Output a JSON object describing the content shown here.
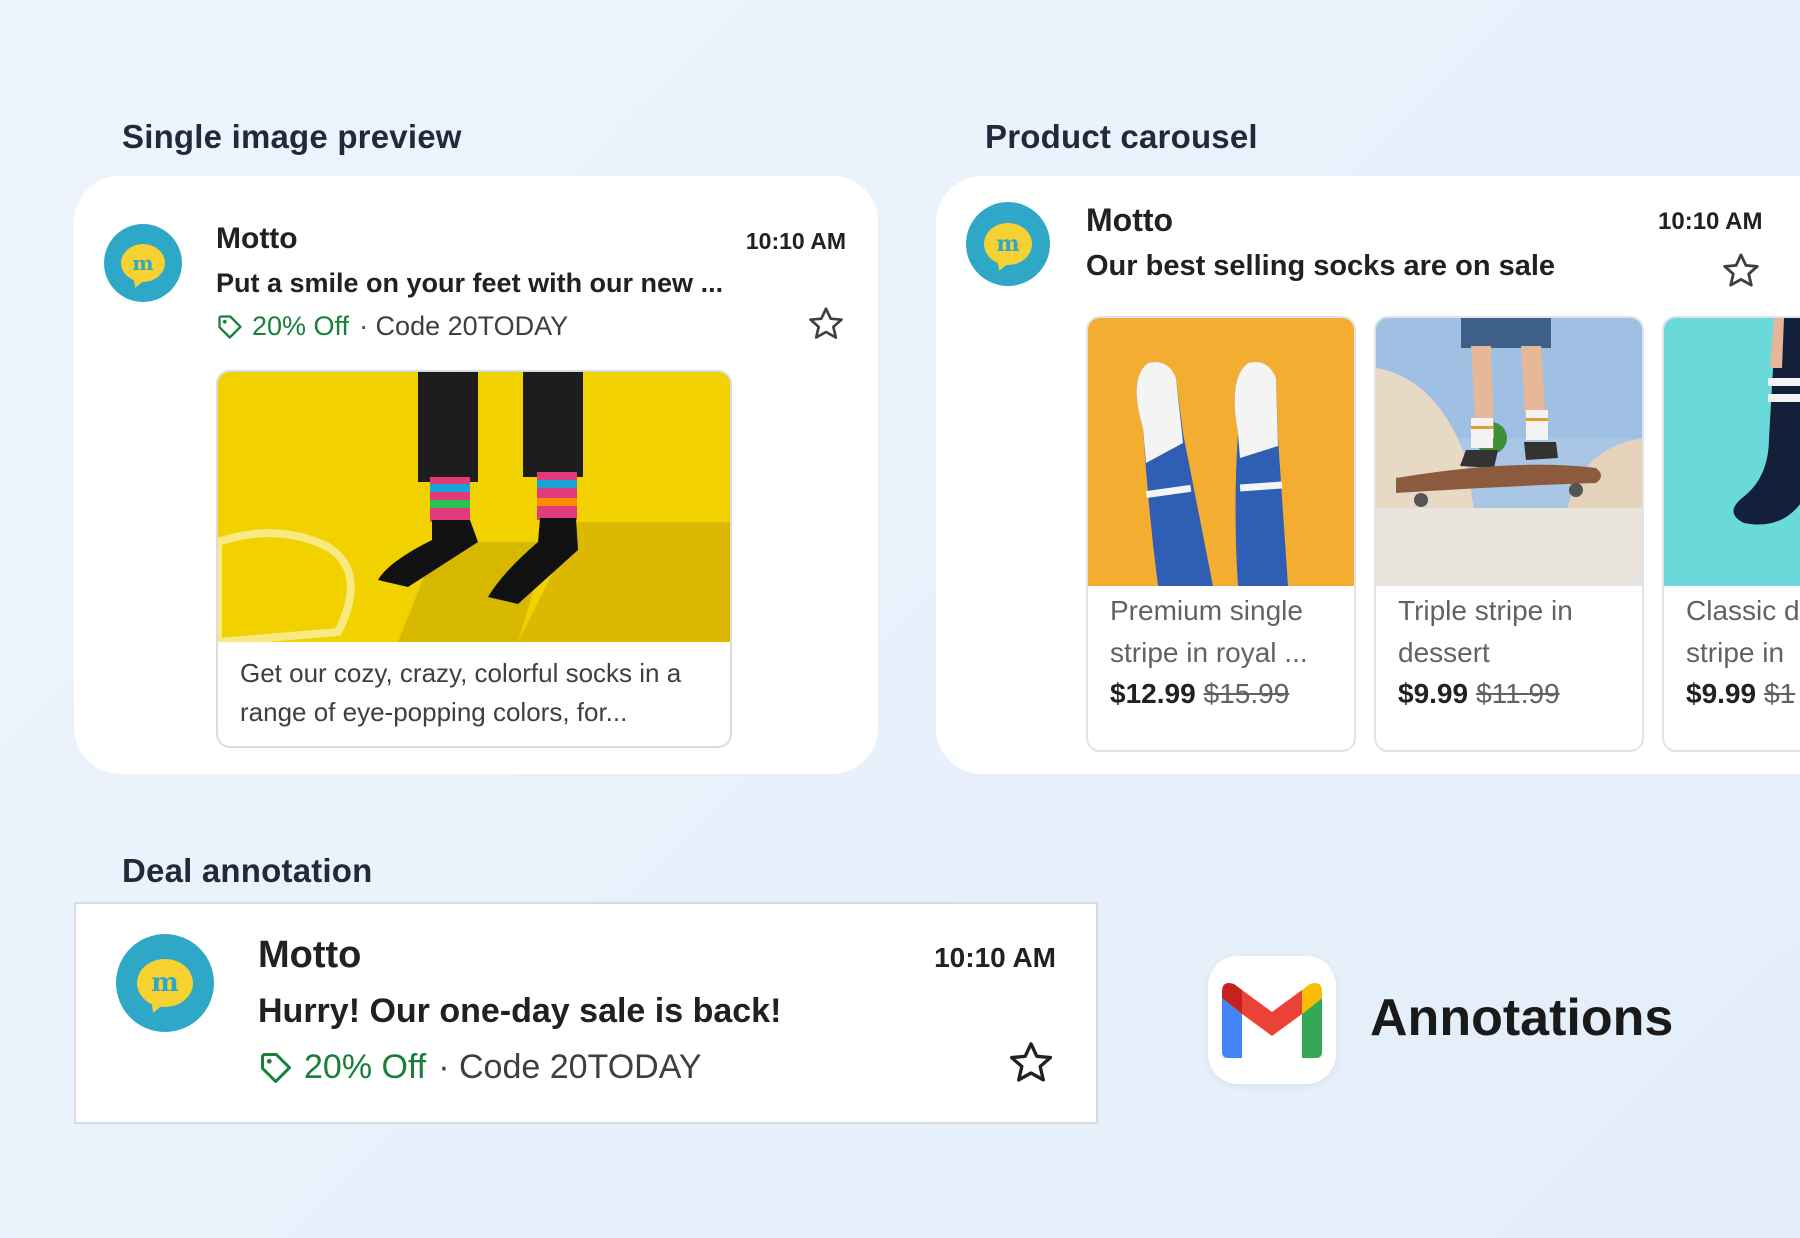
{
  "sections": {
    "single_image_title": "Single image preview",
    "carousel_title": "Product carousel",
    "deal_title": "Deal annotation"
  },
  "colors": {
    "avatar_bg": "#2fa8c8",
    "avatar_bubble": "#f6d132",
    "deal_green": "#188038"
  },
  "single": {
    "avatar_letter": "m",
    "sender": "Motto",
    "time": "10:10 AM",
    "subject": "Put a smile on your feet with our new ...",
    "deal_amount": "20% Off",
    "deal_code": "· Code 20TODAY",
    "star_icon": "star-outline-icon",
    "caption": "Get our cozy, crazy, colorful socks in a range of eye-popping colors, for..."
  },
  "carousel": {
    "avatar_letter": "m",
    "sender": "Motto",
    "time": "10:10 AM",
    "subject": "Our best selling socks are on sale",
    "star_icon": "star-outline-icon",
    "products": [
      {
        "name": "Premium single stripe in royal ...",
        "price": "$12.99",
        "old_price": "$15.99"
      },
      {
        "name": "Triple stripe in dessert",
        "price": "$9.99",
        "old_price": "$11.99"
      },
      {
        "name": "Classic d stripe in",
        "price": "$9.99",
        "old_price": "$1"
      }
    ]
  },
  "deal": {
    "avatar_letter": "m",
    "sender": "Motto",
    "time": "10:10 AM",
    "subject": "Hurry! Our one-day sale is back!",
    "deal_amount": "20% Off",
    "deal_code": "· Code 20TODAY",
    "star_icon": "star-outline-icon"
  },
  "branding": {
    "logo_icon": "gmail-logo-icon",
    "label": "Annotations"
  }
}
